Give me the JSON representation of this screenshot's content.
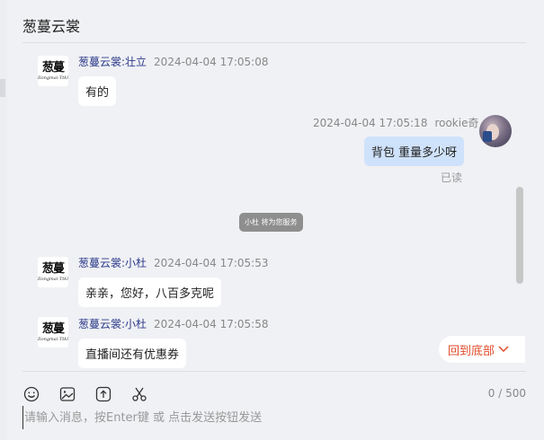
{
  "header": {
    "title": "葱蔓云裳"
  },
  "logo": {
    "main": "葱蔓",
    "sub": "Ilongmai·Ttkl"
  },
  "messages": [
    {
      "sender": "葱蔓云裳:壮立",
      "time": "2024-04-04 17:05:08",
      "text": "有的"
    },
    {
      "sender": "rookie奇",
      "time": "2024-04-04 17:05:18",
      "text": "背包 重量多少呀",
      "status": "已读"
    },
    {
      "system": "小杜 将为您服务"
    },
    {
      "sender": "葱蔓云裳:小杜",
      "time": "2024-04-04 17:05:53",
      "text": "亲亲，您好，八百多克呢"
    },
    {
      "sender": "葱蔓云裳:小杜",
      "time": "2024-04-04 17:05:58",
      "text": "直播间还有优惠券"
    }
  ],
  "back_to_bottom": "回到底部",
  "toolbar": {
    "icons": [
      "emoji-icon",
      "image-icon",
      "upload-icon",
      "scissors-icon"
    ],
    "counter": "0 / 500"
  },
  "input": {
    "placeholder": "请输入消息，按Enter键 或 点击发送按钮发送",
    "value": ""
  },
  "colors": {
    "accent_red": "#e04b2a",
    "bubble_mine": "#cfe2fb",
    "sender_name": "#2b3a8a"
  }
}
